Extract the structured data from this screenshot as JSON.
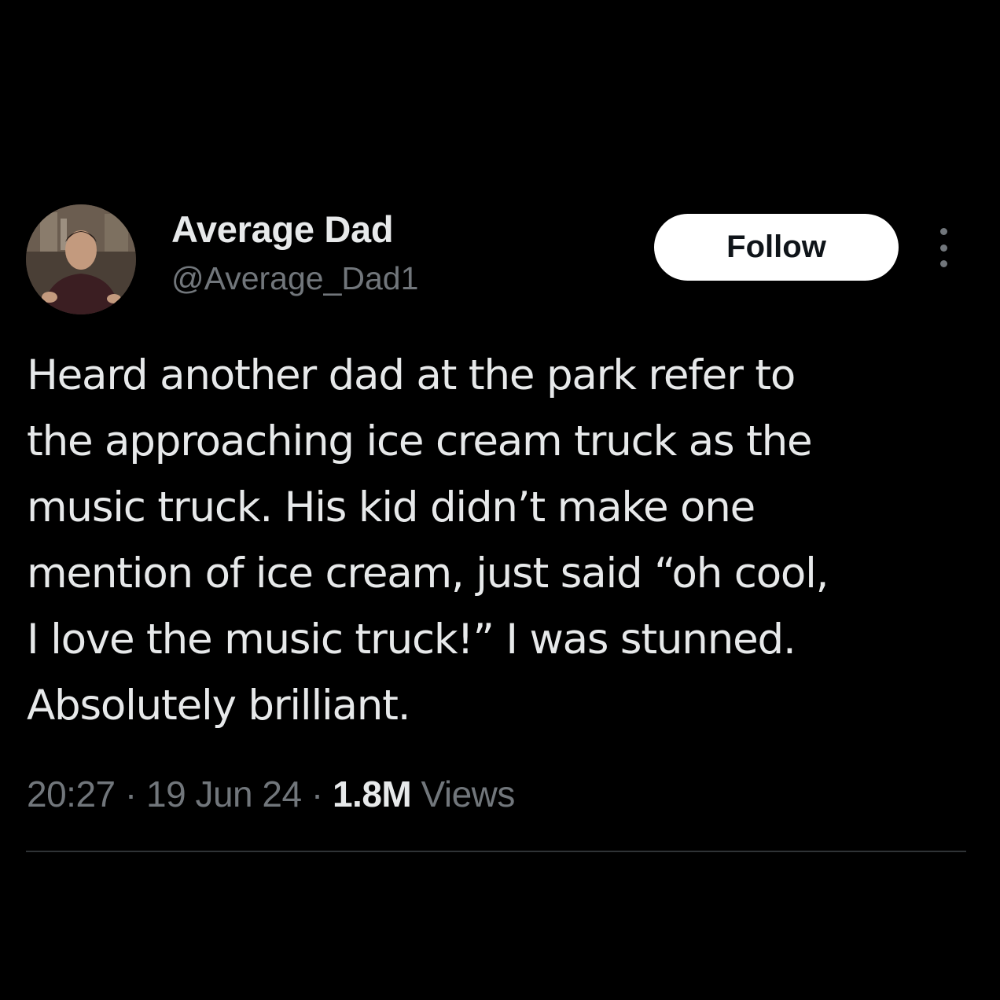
{
  "author": {
    "display_name": "Average Dad",
    "handle": "@Average_Dad1",
    "avatar_icon": "user-avatar-photo"
  },
  "actions": {
    "follow_label": "Follow",
    "more_icon": "more-vertical-icon"
  },
  "tweet": {
    "lines": [
      "Heard another dad at the park refer to",
      "the approaching ice cream truck as the",
      "music truck. His kid didn’t make one",
      "mention of ice cream, just said “oh cool,",
      "I love the music truck!” I was stunned.",
      "Absolutely brilliant."
    ]
  },
  "meta": {
    "time": "20:27",
    "separator": "·",
    "date": "19 Jun 24",
    "views_count": "1.8M",
    "views_label": "Views"
  },
  "colors": {
    "background": "#000000",
    "primary_text": "#e7e9ea",
    "secondary_text": "#71767b",
    "follow_button_bg": "#ffffff",
    "divider": "#2f3336"
  }
}
